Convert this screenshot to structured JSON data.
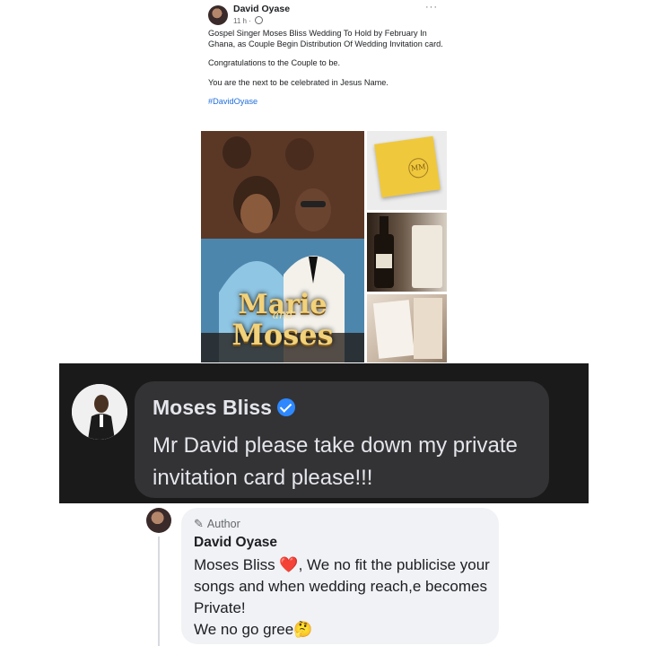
{
  "post": {
    "author": "David Oyase",
    "time": "11 h ·",
    "more": "···",
    "paragraphs": [
      "Gospel Singer Moses Bliss Wedding To Hold by February In Ghana, as Couple Begin Distribution Of Wedding Invitation card.",
      "Congratulations to the Couple to be.",
      "You are the next to be celebrated in Jesus Name."
    ],
    "hashtag": "#DavidOyase",
    "poster": {
      "title_line1": "Marie",
      "title_and": "and",
      "title_line2": "Moses"
    },
    "card_monogram": "MM"
  },
  "comment": {
    "name": "Moses Bliss",
    "text": "Mr David please take down my private invitation card please!!!"
  },
  "reply": {
    "badge": "Author",
    "name": "David Oyase",
    "line1_prefix": "Moses Bliss",
    "heart": "❤️",
    "line1_suffix": ", We no fit the publicise your songs and when wedding reach,e becomes Private!",
    "line2": "We no go gree🤔"
  },
  "colors": {
    "link": "#216fdb",
    "verified": "#2d88ff",
    "dark_bubble": "#333335",
    "light_bubble": "#f0f2f5"
  }
}
